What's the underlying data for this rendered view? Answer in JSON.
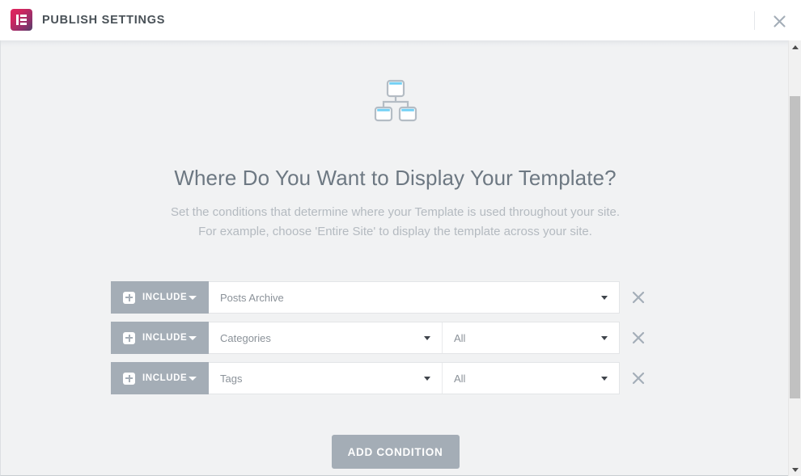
{
  "header": {
    "title": "PUBLISH SETTINGS",
    "logo_icon": "elementor-logo-icon",
    "close_icon": "close-icon",
    "logo_gradient_start": "#e0245e",
    "logo_gradient_end": "#524068"
  },
  "main": {
    "hero_icon": "sitemap-icon",
    "title": "Where Do You Want to Display Your Template?",
    "subtitle_line1": "Set the conditions that determine where your Template is used throughout your site.",
    "subtitle_line2": "For example, choose 'Entire Site' to display the template across your site.",
    "accent_color": "#a4adb6",
    "icon_accent_color": "#6ec6f0"
  },
  "conditions": {
    "rows": [
      {
        "type_label": "INCLUDE",
        "type_icon": "plus-icon",
        "type_caret_icon": "chevron-down-icon",
        "selects": [
          {
            "value": "Posts Archive",
            "width": "full",
            "caret_icon": "chevron-down-icon"
          }
        ],
        "remove_icon": "close-icon"
      },
      {
        "type_label": "INCLUDE",
        "type_icon": "plus-icon",
        "type_caret_icon": "chevron-down-icon",
        "selects": [
          {
            "value": "Categories",
            "width": "half-left",
            "caret_icon": "chevron-down-icon"
          },
          {
            "value": "All",
            "width": "half-right",
            "caret_icon": "chevron-down-icon"
          }
        ],
        "remove_icon": "close-icon"
      },
      {
        "type_label": "INCLUDE",
        "type_icon": "plus-icon",
        "type_caret_icon": "chevron-down-icon",
        "selects": [
          {
            "value": "Tags",
            "width": "half-left",
            "caret_icon": "chevron-down-icon"
          },
          {
            "value": "All",
            "width": "half-right",
            "caret_icon": "chevron-down-icon"
          }
        ],
        "remove_icon": "close-icon"
      }
    ]
  },
  "footer": {
    "add_condition_label": "ADD CONDITION"
  },
  "scrollbar": {
    "up_icon": "triangle-up-icon",
    "down_icon": "triangle-down-icon",
    "thumb": "scroll-thumb"
  }
}
